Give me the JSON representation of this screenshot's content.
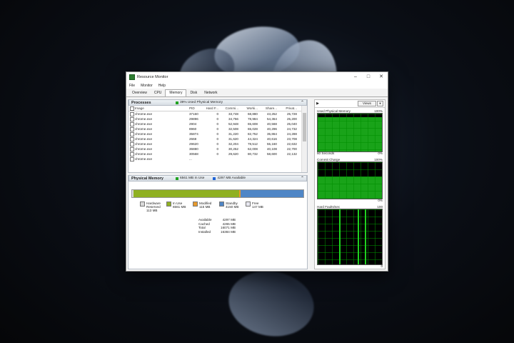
{
  "window": {
    "title": "Resource Monitor"
  },
  "menu": [
    "File",
    "Monitor",
    "Help"
  ],
  "tabs": [
    "Overview",
    "CPU",
    "Memory",
    "Disk",
    "Network"
  ],
  "active_tab": "Memory",
  "processes": {
    "title": "Processes",
    "stat": "39% Used Physical Memory",
    "columns": [
      "Image",
      "PID",
      "Hard F...",
      "Commi...",
      "Worki...",
      "Share...",
      "Privat..."
    ],
    "rows": [
      [
        "chrome.exe",
        "37160",
        "0",
        "33,748",
        "68,880",
        "43,252",
        "25,728"
      ],
      [
        "chrome.exe",
        "29896",
        "0",
        "34,756",
        "78,984",
        "54,364",
        "25,200"
      ],
      [
        "chrome.exe",
        "2904",
        "0",
        "52,948",
        "65,608",
        "40,568",
        "25,040"
      ],
      [
        "chrome.exe",
        "8960",
        "0",
        "32,508",
        "65,028",
        "40,296",
        "24,732"
      ],
      [
        "chrome.exe",
        "35874",
        "0",
        "31,220",
        "82,752",
        "35,864",
        "24,288"
      ],
      [
        "chrome.exe",
        "2668",
        "0",
        "31,620",
        "44,324",
        "40,616",
        "23,708"
      ],
      [
        "chrome.exe",
        "29620",
        "0",
        "32,204",
        "78,512",
        "55,160",
        "22,632"
      ],
      [
        "chrome.exe",
        "36880",
        "0",
        "30,252",
        "62,008",
        "40,108",
        "22,700"
      ],
      [
        "chrome.exe",
        "30568",
        "0",
        "29,620",
        "80,732",
        "58,600",
        "22,132"
      ],
      [
        "chrome.exe",
        "...",
        "",
        "",
        "",
        "",
        ""
      ]
    ]
  },
  "physical_memory": {
    "title": "Physical Memory",
    "in_use_stat": "6561 MB In Use",
    "available_stat": "4297 MB Available",
    "bar": {
      "hardware_reserved_fraction": 0.007,
      "in_use_fraction": 0.617,
      "modified_fraction": 0.011,
      "standby_fraction": 0.365,
      "free_fraction": 0.0
    },
    "legend": [
      {
        "label": "Hardware Reserved",
        "value": "113 MB",
        "color": "#d9d9d9"
      },
      {
        "label": "In Use",
        "value": "6561 MB",
        "color": "#8fb021"
      },
      {
        "label": "Modified",
        "value": "115 MB",
        "color": "#e89a2c"
      },
      {
        "label": "Standby",
        "value": "4150 MB",
        "color": "#4f86c6"
      },
      {
        "label": "Free",
        "value": "147 MB",
        "color": "#e8e8f0"
      }
    ],
    "stats": [
      {
        "label": "Available",
        "value": "4297 MB"
      },
      {
        "label": "Cached",
        "value": "4265 MB"
      },
      {
        "label": "Total",
        "value": "16071 MB"
      },
      {
        "label": "Installed",
        "value": "16384 MB"
      }
    ]
  },
  "right_panel": {
    "views_label": "Views",
    "graphs": [
      {
        "title": "Used Physical Memory",
        "top_right": "100%",
        "bottom_left": "60 Seconds",
        "bottom_right": "0%",
        "level": 0.9
      },
      {
        "title": "Commit Charge",
        "top_right": "100%",
        "bottom_left": "",
        "bottom_right": "0%",
        "level": 0.6
      },
      {
        "title": "Hard Faults/sec",
        "top_right": "100",
        "bottom_left": "",
        "bottom_right": "0",
        "level": 0
      }
    ]
  },
  "colors": {
    "graph_green": "#19a319",
    "accent_blue": "#1e63d6"
  }
}
